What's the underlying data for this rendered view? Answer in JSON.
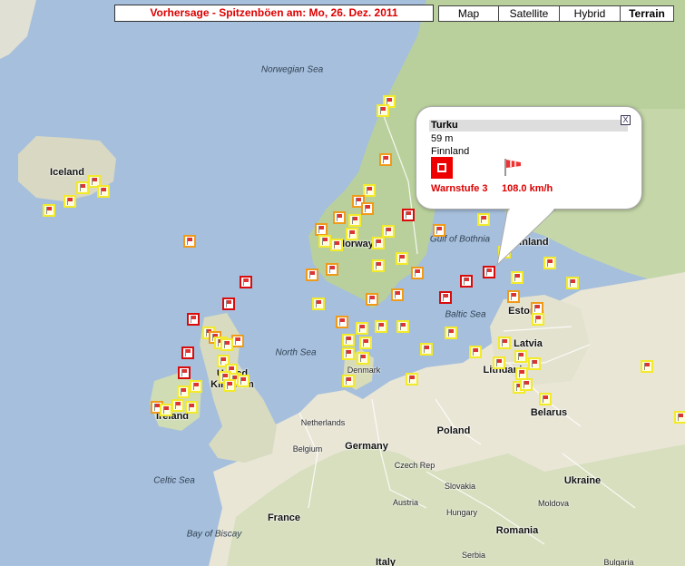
{
  "header": {
    "title": "Vorhersage - Spitzenböen am: Mo, 26. Dez. 2011"
  },
  "map_types": [
    {
      "label": "Map",
      "active": false
    },
    {
      "label": "Satellite",
      "active": false
    },
    {
      "label": "Hybrid",
      "active": false
    },
    {
      "label": "Terrain",
      "active": true
    }
  ],
  "colors": {
    "sea": "#a6bfdd",
    "land": "#e9e6d6",
    "terrain_green": "#b7cf9b",
    "warn_1": "#f2ea2a",
    "warn_2": "#f09a1a",
    "warn_3": "#d80c0c",
    "alert_text": "#dd0000"
  },
  "country_labels": [
    "Iceland",
    "Norway",
    "Finland",
    "Estonia",
    "Latvia",
    "Lithuania",
    "Belarus",
    "Poland",
    "Denmark",
    "Germany",
    "Netherlands",
    "Belgium",
    "United Kingdom",
    "Ireland",
    "France",
    "Czech Rep",
    "Slovakia",
    "Austria",
    "Hungary",
    "Romania",
    "Ukraine",
    "Moldova",
    "Serbia",
    "Italy",
    "Bulgaria"
  ],
  "water_labels": [
    "Norwegian Sea",
    "Gulf of Bothnia",
    "Baltic Sea",
    "North Sea",
    "Celtic Sea",
    "Bay of Biscay"
  ],
  "info_window": {
    "station": "Turku",
    "elevation": "59 m",
    "country": "Finnland",
    "warning": "Warnstufe 3",
    "wind": "108.0  km/h",
    "close_label": "X"
  },
  "marker_summary": {
    "level_1_color": "yellow",
    "level_2_color": "orange",
    "level_3_color": "red"
  }
}
